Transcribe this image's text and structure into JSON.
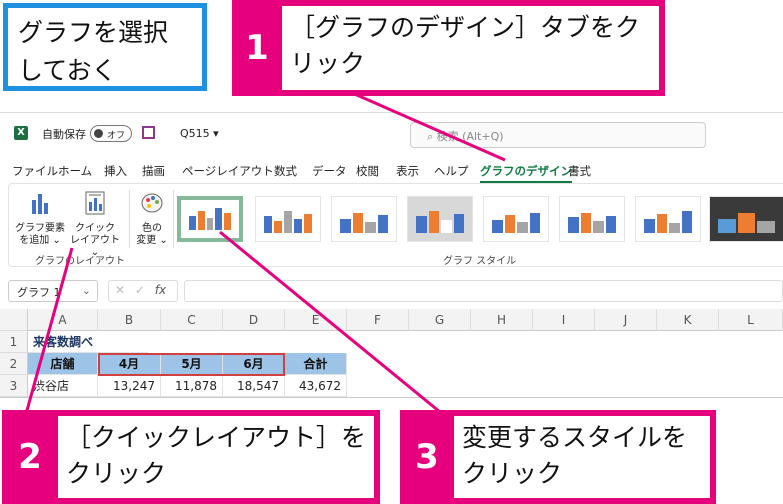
{
  "callouts": {
    "note": "グラフを選択しておく",
    "step1": {
      "number": "1",
      "text": "［グラフのデザイン］タブをクリック"
    },
    "step2": {
      "number": "2",
      "text": "［クイックレイアウト］をクリック"
    },
    "step3": {
      "number": "3",
      "text": "変更するスタイルをクリック"
    }
  },
  "titlebar": {
    "autosave_label": "自動保存",
    "autosave_state": "オフ",
    "filename": "Q515 ▾",
    "search_placeholder": "検索 (Alt+Q)"
  },
  "tabs": [
    "ファイル",
    "ホーム",
    "挿入",
    "描画",
    "ページレイアウト",
    "数式",
    "データ",
    "校閲",
    "表示",
    "ヘルプ",
    "グラフのデザイン",
    "書式"
  ],
  "ribbon": {
    "add_element": "グラフ要素を追加",
    "add_element_l1": "グラフ要素",
    "add_element_l2": "を追加 ⌄",
    "quick_layout_l1": "クイック",
    "quick_layout_l2": "レイアウト ⌄",
    "change_color_l1": "色の",
    "change_color_l2": "変更 ⌄",
    "group_layout": "グラフのレイアウト",
    "group_styles": "グラフ スタイル"
  },
  "formula_bar": {
    "name_box": "グラフ 1",
    "fx": "fx"
  },
  "grid": {
    "columns": [
      "A",
      "B",
      "C",
      "D",
      "E",
      "F",
      "G",
      "H",
      "I",
      "J",
      "K",
      "L"
    ],
    "rows": [
      "1",
      "2",
      "3"
    ],
    "a1": "来客数調べ",
    "headers": [
      "店舗",
      "4月",
      "5月",
      "6月",
      "合計"
    ],
    "row3": [
      "渋谷店",
      "13,247",
      "11,878",
      "18,547",
      "43,672"
    ]
  },
  "colors": {
    "accent_magenta": "#e6007e",
    "note_blue": "#1e90e0",
    "excel_green": "#107c41",
    "header_fill": "#9dc3e6"
  }
}
